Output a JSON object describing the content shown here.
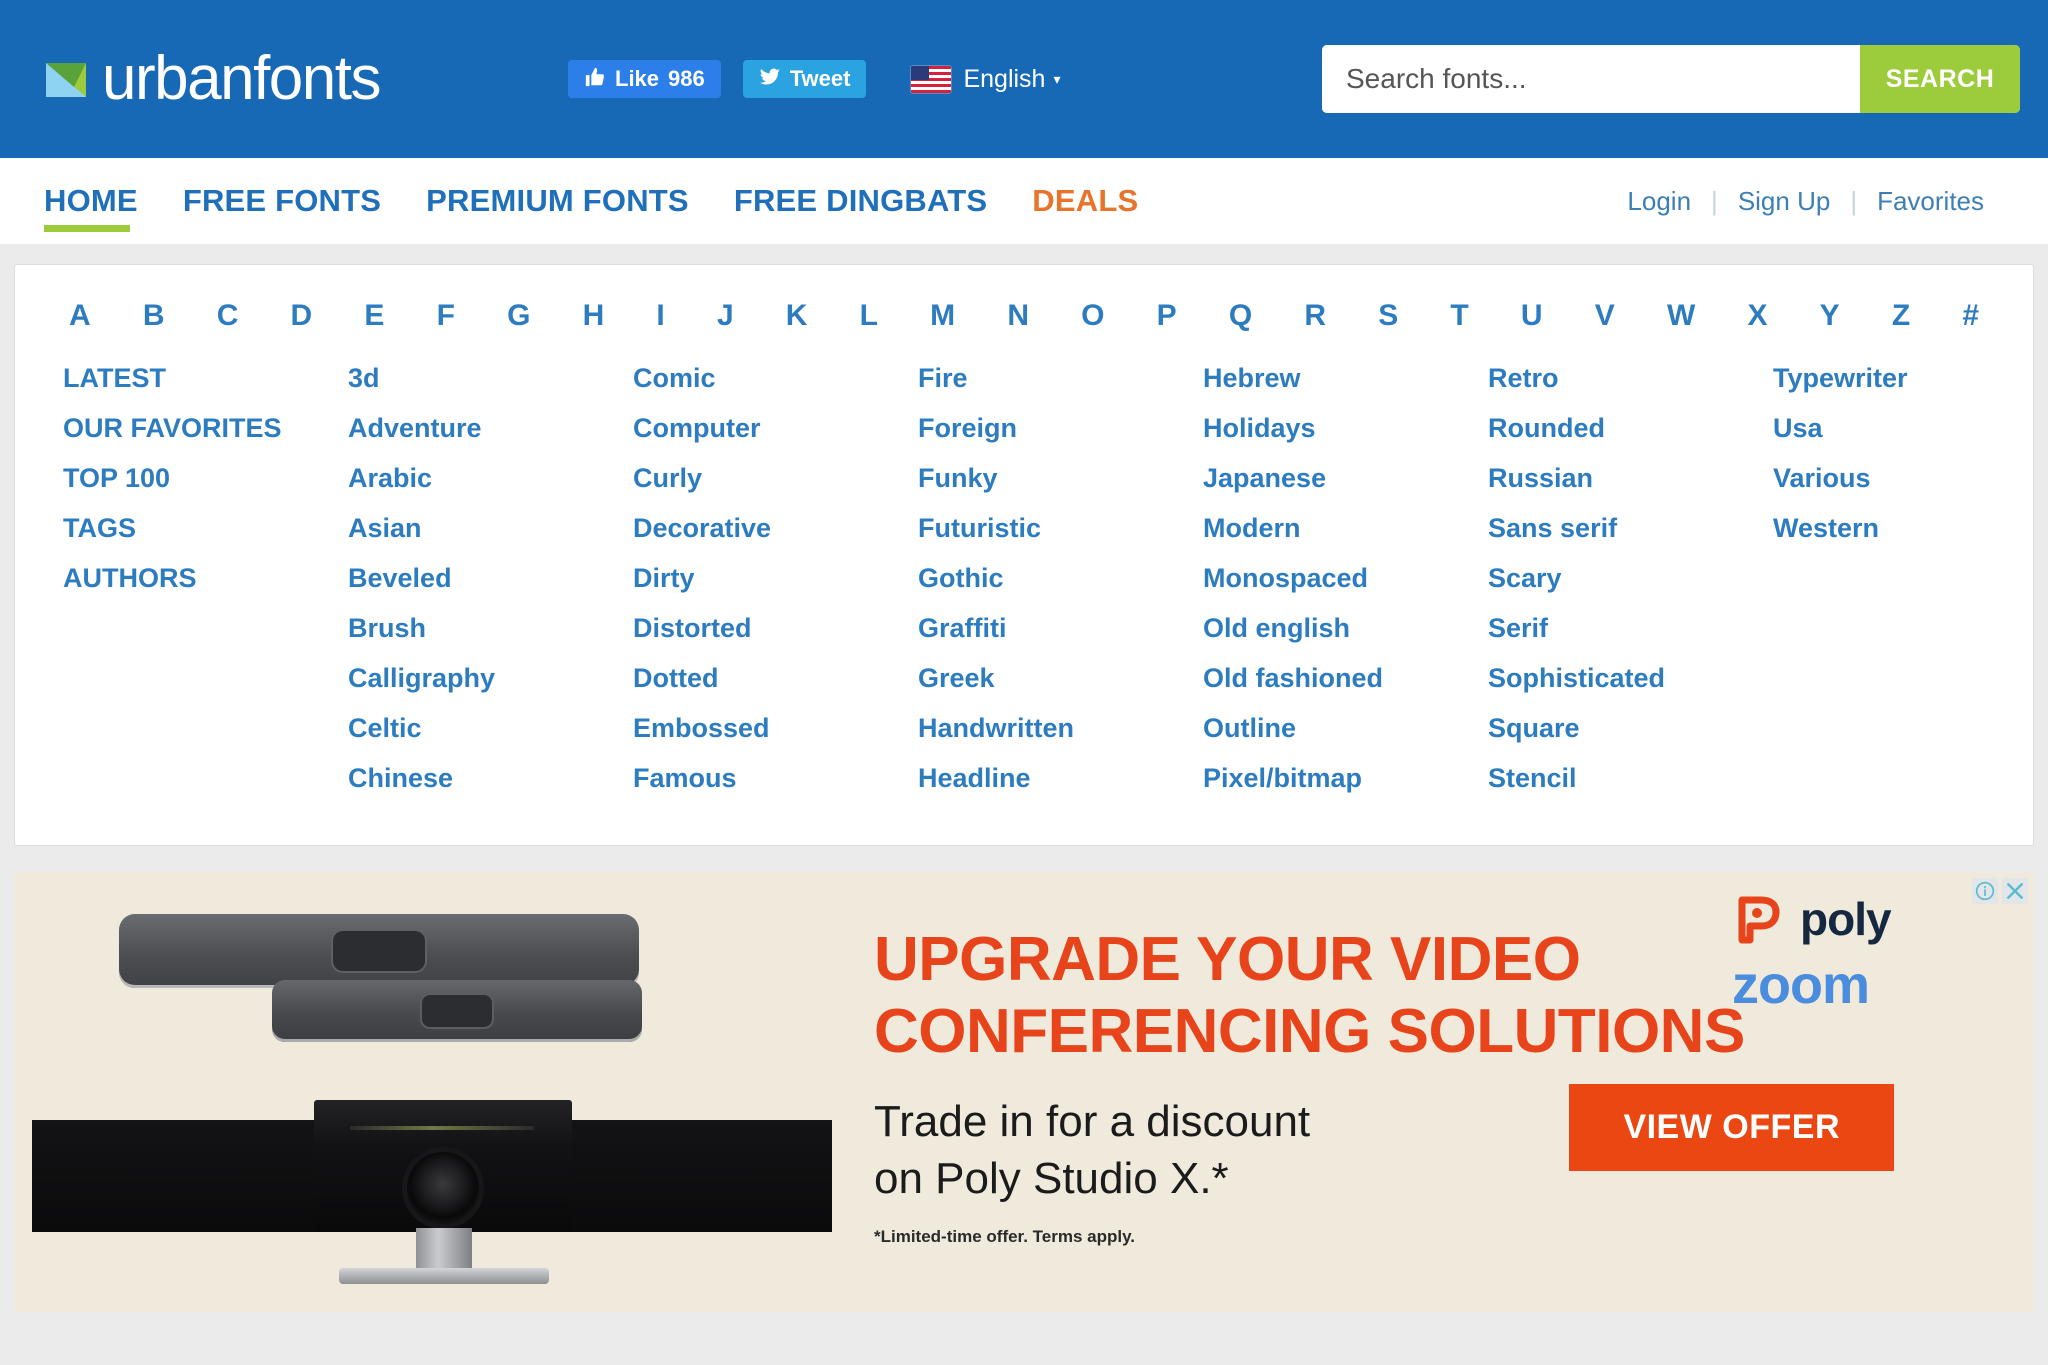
{
  "header": {
    "logo_text": "urbanfonts",
    "logo_icon": "urbanfonts-triangle-logo",
    "facebook_like_label": "Like",
    "facebook_like_count": "986",
    "twitter_label": "Tweet",
    "language": "English",
    "language_caret": "▾",
    "search_placeholder": "Search fonts...",
    "search_value": "",
    "search_button": "SEARCH",
    "bar_color": "#1769b5",
    "accent_green": "#9ccb3b"
  },
  "nav": {
    "items": [
      {
        "label": "HOME",
        "active": true
      },
      {
        "label": "FREE FONTS",
        "active": false
      },
      {
        "label": "PREMIUM FONTS",
        "active": false
      },
      {
        "label": "FREE DINGBATS",
        "active": false
      },
      {
        "label": "DEALS",
        "active": false,
        "highlight": "#e8742c"
      }
    ],
    "account_links": [
      "Login",
      "Sign Up",
      "Favorites"
    ],
    "separator": "|"
  },
  "browse": {
    "alphabet": [
      "A",
      "B",
      "C",
      "D",
      "E",
      "F",
      "G",
      "H",
      "I",
      "J",
      "K",
      "L",
      "M",
      "N",
      "O",
      "P",
      "Q",
      "R",
      "S",
      "T",
      "U",
      "V",
      "W",
      "X",
      "Y",
      "Z",
      "#"
    ],
    "columns": [
      [
        "LATEST",
        "OUR FAVORITES",
        "TOP 100",
        "TAGS",
        "AUTHORS"
      ],
      [
        "3d",
        "Adventure",
        "Arabic",
        "Asian",
        "Beveled",
        "Brush",
        "Calligraphy",
        "Celtic",
        "Chinese"
      ],
      [
        "Comic",
        "Computer",
        "Curly",
        "Decorative",
        "Dirty",
        "Distorted",
        "Dotted",
        "Embossed",
        "Famous"
      ],
      [
        "Fire",
        "Foreign",
        "Funky",
        "Futuristic",
        "Gothic",
        "Graffiti",
        "Greek",
        "Handwritten",
        "Headline"
      ],
      [
        "Hebrew",
        "Holidays",
        "Japanese",
        "Modern",
        "Monospaced",
        "Old english",
        "Old fashioned",
        "Outline",
        "Pixel/bitmap"
      ],
      [
        "Retro",
        "Rounded",
        "Russian",
        "Sans serif",
        "Scary",
        "Serif",
        "Sophisticated",
        "Square",
        "Stencil"
      ],
      [
        "Typewriter",
        "Usa",
        "Various",
        "Western"
      ]
    ],
    "link_color": "#2d7cc0"
  },
  "ad": {
    "headline_line1": "UPGRADE YOUR VIDEO",
    "headline_line2": "CONFERENCING SOLUTIONS",
    "subhead_line1": "Trade in for a discount",
    "subhead_line2": "on Poly Studio X.*",
    "disclaimer": "*Limited-time offer. Terms apply.",
    "cta_label": "VIEW OFFER",
    "brand_primary": "poly",
    "brand_secondary": "zoom",
    "info_icon": "adchoices-info-icon",
    "close_icon": "ad-close-icon",
    "headline_color": "#e8441c",
    "cta_color": "#ea4713",
    "background": "#efeadb"
  }
}
